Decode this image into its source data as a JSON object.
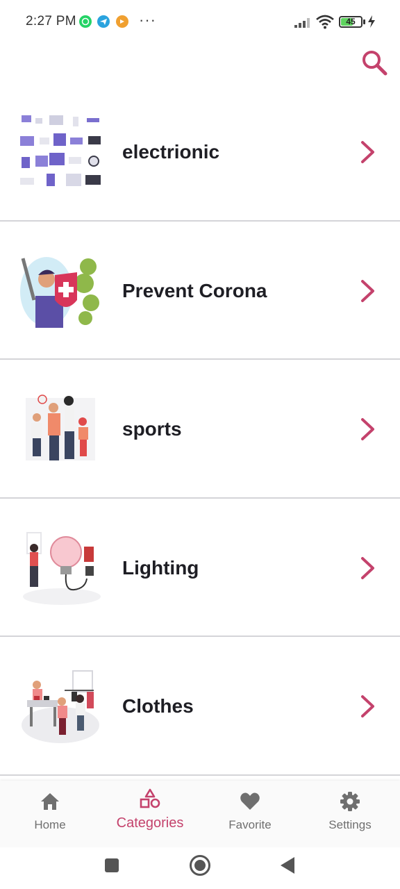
{
  "status_bar": {
    "time": "2:27 PM",
    "more": "···",
    "battery": "45",
    "icons": [
      "whatsapp-icon",
      "telegram-icon",
      "notification-icon",
      "signal-icon",
      "wifi-icon",
      "battery-icon",
      "charging-icon"
    ]
  },
  "app_bar": {
    "search_icon": "search-icon"
  },
  "categories": [
    {
      "name": "electrionic",
      "image": "electronics-illustration"
    },
    {
      "name": "Prevent Corona",
      "image": "prevent-corona-illustration"
    },
    {
      "name": "sports",
      "image": "sports-illustration"
    },
    {
      "name": "Lighting",
      "image": "lighting-illustration"
    },
    {
      "name": "Clothes",
      "image": "clothes-illustration"
    }
  ],
  "bottom_nav": {
    "items": [
      {
        "label": "Home",
        "icon": "home-icon"
      },
      {
        "label": "Categories",
        "icon": "categories-icon"
      },
      {
        "label": "Favorite",
        "icon": "heart-icon"
      },
      {
        "label": "Settings",
        "icon": "gear-icon"
      }
    ],
    "active": "Categories"
  },
  "colors": {
    "accent": "#c4426c",
    "inactive": "#6f6f6f",
    "divider": "#d4d4d8",
    "text": "#1e1e24"
  }
}
